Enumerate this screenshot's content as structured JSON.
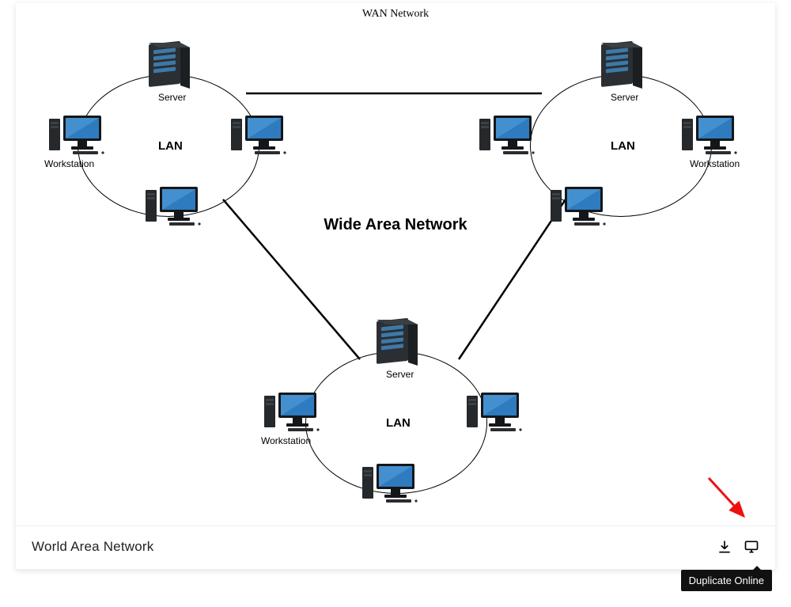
{
  "diagram_header": "WAN Network",
  "center_label_line1": "Wide Area Network",
  "center_label_line2": "Network",
  "lan_label": "LAN",
  "server_label": "Server",
  "workstation_label": "Workstation",
  "footer": {
    "title": "World Area Network",
    "tooltip": "Duplicate Online"
  },
  "chart_data": {
    "type": "network-diagram",
    "title": "WAN Network",
    "center_caption": "Wide Area Network",
    "clusters": [
      {
        "id": "lan-top-left",
        "label": "LAN",
        "nodes": [
          {
            "role": "Server",
            "position": "top"
          },
          {
            "role": "Workstation",
            "position": "left"
          },
          {
            "role": "Workstation",
            "position": "right"
          },
          {
            "role": "Workstation",
            "position": "bottom"
          }
        ]
      },
      {
        "id": "lan-top-right",
        "label": "LAN",
        "nodes": [
          {
            "role": "Server",
            "position": "top"
          },
          {
            "role": "Workstation",
            "position": "left"
          },
          {
            "role": "Workstation",
            "position": "right"
          },
          {
            "role": "Workstation",
            "position": "bottom"
          }
        ]
      },
      {
        "id": "lan-bottom",
        "label": "LAN",
        "nodes": [
          {
            "role": "Server",
            "position": "top"
          },
          {
            "role": "Workstation",
            "position": "left"
          },
          {
            "role": "Workstation",
            "position": "right"
          },
          {
            "role": "Workstation",
            "position": "bottom"
          }
        ]
      }
    ],
    "links": [
      {
        "from": "lan-top-left",
        "to": "lan-top-right"
      },
      {
        "from": "lan-top-left",
        "to": "lan-bottom"
      },
      {
        "from": "lan-top-right",
        "to": "lan-bottom"
      }
    ]
  }
}
